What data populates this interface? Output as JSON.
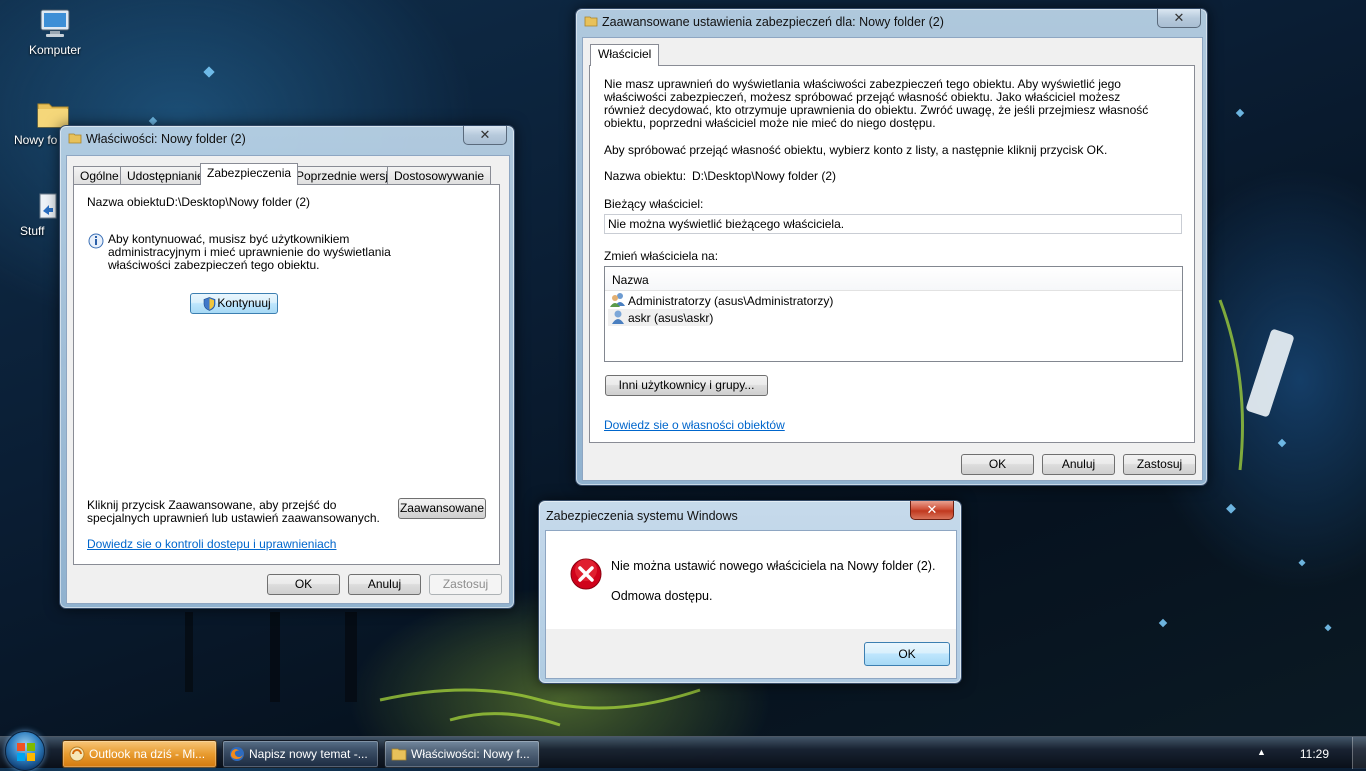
{
  "desktop": {
    "icons": [
      {
        "label": "Komputer"
      },
      {
        "label": "Nowy fo"
      },
      {
        "label": "Stuff"
      }
    ]
  },
  "props_window": {
    "title": "Właściwości: Nowy folder (2)",
    "tabs": [
      {
        "label": "Ogólne"
      },
      {
        "label": "Udostępnianie"
      },
      {
        "label": "Zabezpieczenia"
      },
      {
        "label": "Poprzednie wersje"
      },
      {
        "label": "Dostosowywanie"
      }
    ],
    "active_tab": "Zabezpieczenia",
    "object_name_label": "Nazwa obiektu:",
    "object_name_value": "D:\\Desktop\\Nowy folder (2)",
    "info_text": "Aby kontynuować, musisz być użytkownikiem administracyjnym i mieć uprawnienie do wyświetlania właściwości zabezpieczeń tego obiektu.",
    "continue_button": "Kontynuuj",
    "advanced_text": "Kliknij przycisk Zaawansowane, aby przejść do specjalnych uprawnień lub ustawień zaawansowanych.",
    "advanced_button": "Zaawansowane",
    "help_link": "Dowiedz sie o kontroli dostepu i uprawnieniach",
    "buttons": {
      "ok": "OK",
      "cancel": "Anuluj",
      "apply": "Zastosuj"
    }
  },
  "advanced_window": {
    "title": "Zaawansowane ustawienia zabezpieczeń dla: Nowy folder (2)",
    "tab": "Właściciel",
    "message": "Nie masz uprawnień do wyświetlania właściwości zabezpieczeń tego obiektu. Aby wyświetlić jego właściwości zabezpieczeń, możesz spróbować przejąć własność obiektu. Jako właściciel możesz również decydować, kto otrzymuje uprawnienia do obiektu. Zwróć uwagę, że jeśli przejmiesz własność obiektu, poprzedni właściciel może nie mieć do niego dostępu.",
    "instruction": "Aby spróbować przejąć własność obiektu, wybierz konto z listy, a następnie kliknij przycisk OK.",
    "object_name_label": "Nazwa obiektu:",
    "object_name_value": "D:\\Desktop\\Nowy folder (2)",
    "current_owner_label": "Bieżący właściciel:",
    "current_owner_value": "Nie można wyświetlić bieżącego właściciela.",
    "change_owner_label": "Zmień właściciela na:",
    "list_header": "Nazwa",
    "owners": [
      {
        "name": "Administratorzy (asus\\Administratorzy)",
        "icon": "group-users-icon"
      },
      {
        "name": "askr (asus\\askr)",
        "icon": "user-icon"
      }
    ],
    "other_users_button": "Inni użytkownicy i grupy...",
    "help_link": "Dowiedz sie o własności obiektów",
    "buttons": {
      "ok": "OK",
      "cancel": "Anuluj",
      "apply": "Zastosuj"
    }
  },
  "error_dialog": {
    "title": "Zabezpieczenia systemu Windows",
    "message": "Nie można ustawić nowego właściciela na Nowy folder (2).",
    "detail": "Odmowa dostępu.",
    "ok_button": "OK"
  },
  "taskbar": {
    "items": [
      {
        "label": "Outlook na dziś - Mi...",
        "icon": "outlook-icon"
      },
      {
        "label": "Napisz nowy temat -...",
        "icon": "firefox-icon"
      },
      {
        "label": "Właściwości: Nowy f...",
        "icon": "folder-icon"
      }
    ],
    "clock": "11:29"
  },
  "colors": {
    "link": "#0066cc",
    "error_red": "#d0021b",
    "accent": "#3c7fb1"
  }
}
